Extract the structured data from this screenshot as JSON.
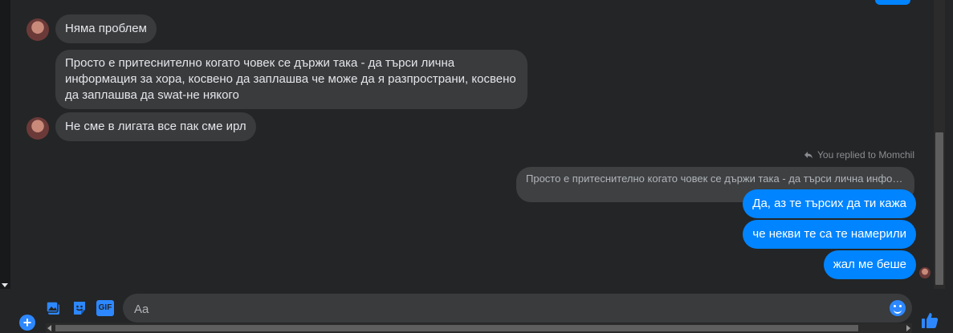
{
  "colors": {
    "accent": "#0084ff",
    "incoming_bubble": "#3a3b3c",
    "background": "#242526"
  },
  "messages": {
    "in1": "Няма проблем",
    "in2": "Просто е притеснително когато човек се държи така - да търси лична информация за хора, косвено да заплашва че може да я разпространи, косвено да заплашва да swat-не някого",
    "in3": "Не сме в лигата все пак сме ирл",
    "replied_label": "You replied to Momchil",
    "reply_quote": "Просто е притеснително когато човек се държи така - да търси лична инфор...",
    "out1": "Да, аз те търсих да ти кажа",
    "out2": "че некви те са те намерили",
    "out3": "жал ме беше"
  },
  "composer": {
    "placeholder": "Aa",
    "gif_label": "GIF",
    "icons": [
      "add-icon",
      "photo-icon",
      "sticker-icon",
      "gif-icon",
      "emoji-icon",
      "thumbs-up-icon"
    ]
  }
}
